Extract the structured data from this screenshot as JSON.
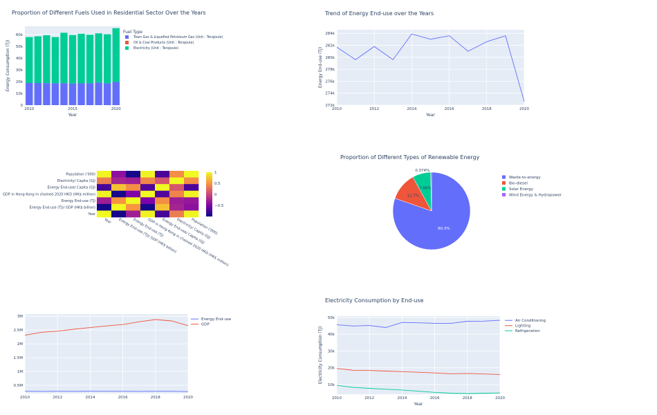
{
  "chart_data": [
    {
      "type": "bar",
      "title": "Proportion of Different Fuels Used in Residential Sector Over the Years",
      "xlabel": "Year",
      "ylabel": "Energy Consumption (TJ)",
      "legend_title": "Fuel Type",
      "legend_position": "top-right",
      "barmode": "stack",
      "grid": true,
      "categories": [
        2010,
        2011,
        2012,
        2013,
        2014,
        2015,
        2016,
        2017,
        2018,
        2019,
        2020
      ],
      "x_ticks": [
        "2010",
        "2015",
        "2020"
      ],
      "y_ticks": [
        "0",
        "10k",
        "20k",
        "30k",
        "40k",
        "50k",
        "60k"
      ],
      "ylim": [
        0,
        67000
      ],
      "series": [
        {
          "name": "Town Gas & Liquefied Petroleum Gas (Unit : Terajoule)",
          "color": "#636efa",
          "values": [
            18800,
            18800,
            18700,
            18600,
            18700,
            18300,
            18500,
            18600,
            19300,
            18600,
            19700
          ]
        },
        {
          "name": "Oil & Coal Products (Unit : Terajoule)",
          "color": "#ef553b",
          "values": [
            0,
            0,
            0,
            0,
            0,
            0,
            0,
            0,
            0,
            0,
            0
          ]
        },
        {
          "name": "Electricity (Unit : Terajoule)",
          "color": "#00cc96",
          "values": [
            39000,
            39700,
            40700,
            39200,
            42800,
            41300,
            42100,
            41200,
            41700,
            41600,
            45700
          ]
        }
      ]
    },
    {
      "type": "line",
      "title": "Trend of Energy End-use over the Years",
      "xlabel": "Year",
      "ylabel": "Energy End-use (TJ)",
      "grid": true,
      "x_ticks": [
        "2010",
        "2012",
        "2014",
        "2016",
        "2018",
        "2020"
      ],
      "y_ticks": [
        "272k",
        "274k",
        "276k",
        "278k",
        "280k",
        "282k",
        "284k"
      ],
      "xlim": [
        2010,
        2020
      ],
      "ylim": [
        272000,
        284600
      ],
      "series": [
        {
          "name": "",
          "color": "#636efa",
          "x": [
            2010,
            2011,
            2012,
            2013,
            2014,
            2015,
            2016,
            2017,
            2018,
            2019,
            2020
          ],
          "values": [
            281700,
            279600,
            281800,
            279600,
            283900,
            283000,
            283600,
            281000,
            282600,
            283600,
            272600
          ]
        }
      ]
    },
    {
      "type": "heatmap",
      "title": "",
      "row_labels": [
        "Population ('000)",
        "Electricity/ Capita (GJ)",
        "Energy End-use/ Capita (GJ)",
        "GDP in Hong Kong in chained 2020 HKD (HK$ million)",
        "Energy End-use (TJ)",
        "Energy End-use (TJ)/ GDP (HK$ billion)",
        "Year"
      ],
      "col_labels": [
        "Year",
        "Energy End-use (TJ)/ GDP (HK$ billion)",
        "Energy End-use (TJ)",
        "GDP in Hong Kong in chained 2020 HKD (HK$ million)",
        "Energy End-use/ Capita (GJ)",
        "Electricity/ Capita (GJ)",
        "Population ('000)"
      ],
      "colorbar_ticks": [
        "1",
        "0.5",
        "0",
        "−0.5"
      ],
      "zlim": [
        -1,
        1
      ],
      "values": [
        [
          0.98,
          -0.4,
          -0.95,
          0.97,
          -0.72,
          0.45,
          1.0
        ],
        [
          0.35,
          -0.25,
          -0.3,
          0.4,
          0.1,
          1.0,
          0.45
        ],
        [
          -0.75,
          0.72,
          0.45,
          -0.7,
          1.0,
          0.1,
          -0.72
        ],
        [
          0.97,
          -0.96,
          -0.5,
          1.0,
          -0.7,
          0.4,
          0.97
        ],
        [
          -0.3,
          0.5,
          1.0,
          -0.5,
          0.45,
          -0.3,
          -0.35
        ],
        [
          -0.97,
          1.0,
          0.5,
          -0.96,
          0.72,
          -0.25,
          -0.4
        ],
        [
          1.0,
          -0.97,
          -0.3,
          0.97,
          -0.75,
          0.35,
          0.98
        ]
      ]
    },
    {
      "type": "pie",
      "title": "Proportion of Different Types of Renewable Energy",
      "legend_position": "right",
      "slices": [
        {
          "label": "Waste-to-energy",
          "value": 80.3,
          "text": "80.3%",
          "color": "#636efa"
        },
        {
          "label": "Bio-diesel",
          "value": 11.7,
          "text": "11.7%",
          "color": "#ef553b"
        },
        {
          "label": "Solar Energy",
          "value": 7.66,
          "text": "7.66%",
          "color": "#00cc96"
        },
        {
          "label": "Wind Energy & Hydropower",
          "value": 0.374,
          "text": "0.374%",
          "color": "#ab63fa"
        }
      ]
    },
    {
      "type": "line",
      "title": "",
      "xlabel": "",
      "ylabel": "",
      "grid": true,
      "legend_position": "top-right",
      "x_ticks": [
        "2010",
        "2012",
        "2014",
        "2016",
        "2018",
        "2020"
      ],
      "y_ticks": [
        "0.5M",
        "1M",
        "1.5M",
        "2M",
        "2.5M",
        "3M"
      ],
      "xlim": [
        2010,
        2020
      ],
      "ylim": [
        200000,
        3080000
      ],
      "series": [
        {
          "name": "Energy End-use",
          "color": "#636efa",
          "x": [
            2010,
            2011,
            2012,
            2013,
            2014,
            2015,
            2016,
            2017,
            2018,
            2019,
            2020
          ],
          "values": [
            281700,
            279600,
            281800,
            279600,
            283900,
            283000,
            283600,
            281000,
            282600,
            283600,
            272600
          ]
        },
        {
          "name": "GDP",
          "color": "#ef553b",
          "x": [
            2010,
            2011,
            2012,
            2013,
            2014,
            2015,
            2016,
            2017,
            2018,
            2019,
            2020
          ],
          "values": [
            2310000,
            2420000,
            2460000,
            2530000,
            2590000,
            2650000,
            2700000,
            2800000,
            2880000,
            2830000,
            2660000
          ]
        }
      ]
    },
    {
      "type": "line",
      "title": "Electricity Consumption by End-use",
      "xlabel": "Year",
      "ylabel": "Electricity Consumption (TJ)",
      "grid": true,
      "legend_position": "top-right",
      "x_ticks": [
        "2010",
        "2012",
        "2014",
        "2016",
        "2018",
        "2020"
      ],
      "y_ticks": [
        "10k",
        "20k",
        "30k",
        "40k",
        "50k"
      ],
      "xlim": [
        2010,
        2020
      ],
      "ylim": [
        4200,
        50800
      ],
      "series": [
        {
          "name": "Air Conditioning",
          "color": "#636efa",
          "x": [
            2010,
            2011,
            2012,
            2013,
            2014,
            2015,
            2016,
            2017,
            2018,
            2019,
            2020
          ],
          "values": [
            45600,
            44900,
            45200,
            44000,
            47000,
            46800,
            46500,
            46500,
            47700,
            47800,
            48300
          ]
        },
        {
          "name": "Lighting",
          "color": "#ef553b",
          "x": [
            2010,
            2011,
            2012,
            2013,
            2014,
            2015,
            2016,
            2017,
            2018,
            2019,
            2020
          ],
          "values": [
            19600,
            18500,
            18400,
            18000,
            17700,
            17300,
            16900,
            16400,
            16600,
            16300,
            16000
          ]
        },
        {
          "name": "Refrigeration",
          "color": "#00cc96",
          "x": [
            2010,
            2011,
            2012,
            2013,
            2014,
            2015,
            2016,
            2017,
            2018,
            2019,
            2020
          ],
          "values": [
            9500,
            8300,
            7700,
            7200,
            6700,
            6000,
            5300,
            4800,
            4600,
            4800,
            5000
          ]
        }
      ]
    }
  ]
}
